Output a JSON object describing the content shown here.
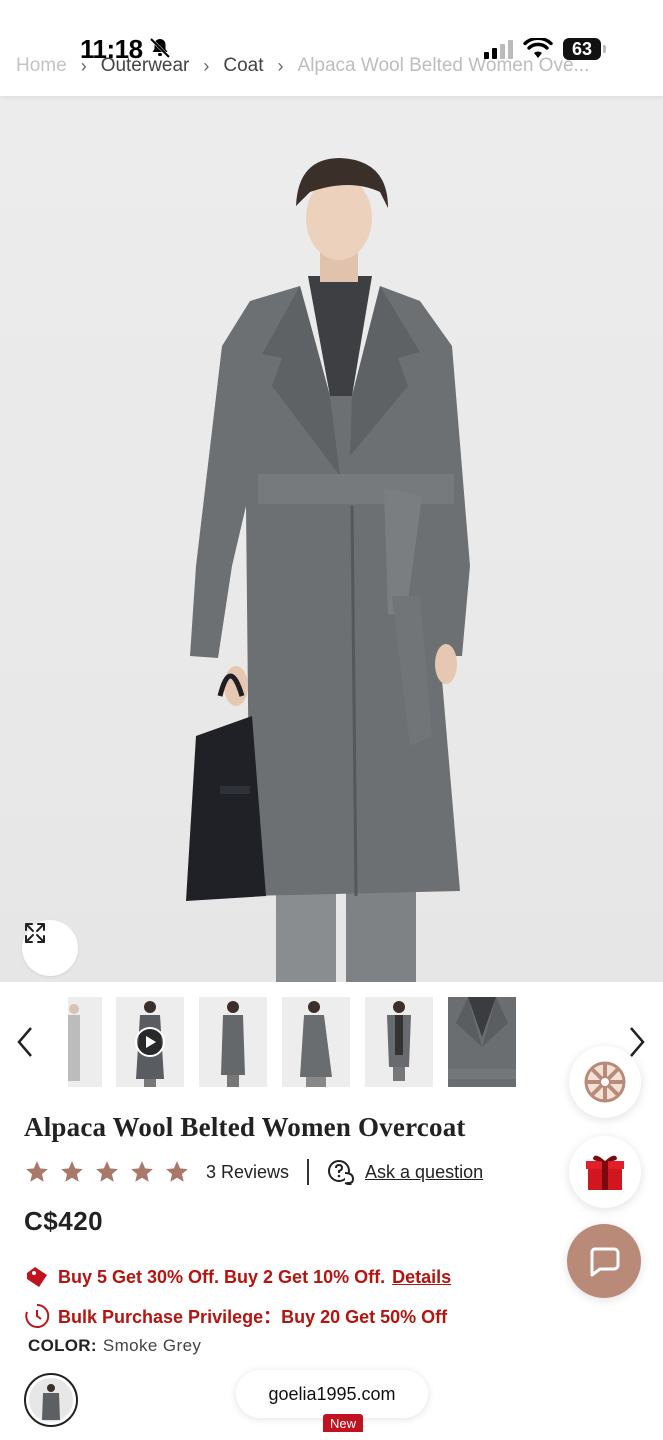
{
  "status_bar": {
    "time": "11:18",
    "battery": "63"
  },
  "breadcrumb": {
    "items": [
      "Home",
      "Outerwear",
      "Coat",
      "Alpaca Wool Belted Women Ove..."
    ],
    "separator": "›"
  },
  "product": {
    "title": "Alpaca Wool Belted Women Overcoat",
    "rating": 5,
    "reviews_label": "3 Reviews",
    "ask_label": "Ask a question",
    "price": "C$420",
    "color_label": "COLOR:",
    "color_value": "Smoke Grey"
  },
  "promotions": {
    "offer_text": "Buy 5 Get 30% Off. Buy 2 Get 10% Off.",
    "offer_link": "Details",
    "bulk_text": "Bulk Purchase Privilege：Buy 20 Get 50% Off"
  },
  "thumbnails": [
    {
      "kind": "partial-grey-coat"
    },
    {
      "kind": "video",
      "has_play": true
    },
    {
      "kind": "side-view"
    },
    {
      "kind": "walking-view"
    },
    {
      "kind": "front-open"
    },
    {
      "kind": "close-up"
    }
  ],
  "floating_buttons": [
    "wheel-icon",
    "gift-icon",
    "chat-icon"
  ],
  "browser": {
    "url": "goelia1995.com",
    "badge": "New"
  },
  "colors": {
    "accent_red": "#b6140f",
    "coat_grey": "#6d7073",
    "chat_button": "#b98a78",
    "star": "#a8786a"
  }
}
